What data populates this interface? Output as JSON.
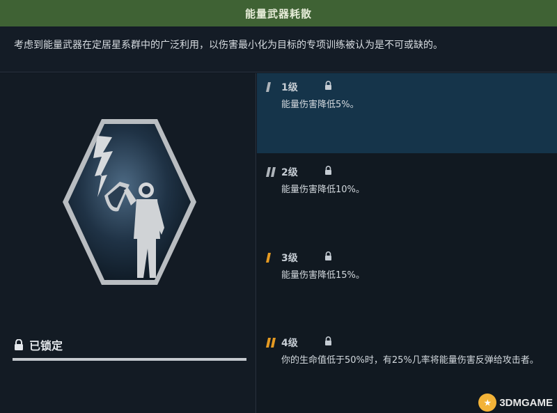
{
  "header": {
    "title": "能量武器耗散"
  },
  "description": "考虑到能量武器在定居星系群中的广泛利用，以伤害最小化为目标的专项训练被认为是不可或缺的。",
  "status": {
    "label": "已锁定"
  },
  "ranks": [
    {
      "level": "1级",
      "effect": "能量伤害降低5%。",
      "active": true,
      "marker_color": "#aeb4ba"
    },
    {
      "level": "2级",
      "effect": "能量伤害降低10%。",
      "active": false,
      "marker_color": "#aeb4ba"
    },
    {
      "level": "3级",
      "effect": "能量伤害降低15%。",
      "active": false,
      "marker_color": "#e59a22"
    },
    {
      "level": "4级",
      "effect": "你的生命值低于50%时，有25%几率将能量伤害反弹给攻击者。",
      "active": false,
      "marker_color": "#e59a22"
    }
  ],
  "watermark": {
    "text": "3DMGAME"
  },
  "colors": {
    "header_bg": "#3f6234",
    "active_rank_bg": "#15344a",
    "page_bg": "#0f1620"
  }
}
